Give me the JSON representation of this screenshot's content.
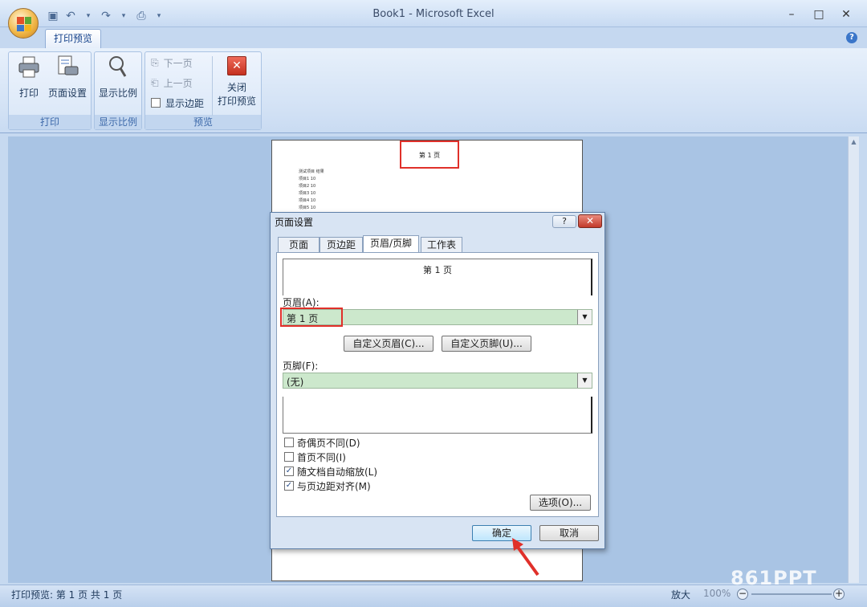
{
  "window": {
    "title": "Book1 - Microsoft Excel",
    "controls": [
      "–",
      "□",
      "✕"
    ]
  },
  "ribbon": {
    "tab": "打印预览",
    "groups": {
      "print": {
        "label": "打印",
        "print_btn": "打印",
        "page_setup_btn": "页面设置"
      },
      "zoom": {
        "label": "显示比例",
        "zoom_btn": "显示比例"
      },
      "preview": {
        "label": "预览",
        "next_page": "下一页",
        "prev_page": "上一页",
        "show_margins": "显示边距",
        "close_line1": "关闭",
        "close_line2": "打印预览"
      }
    }
  },
  "sheet": {
    "header_text": "第 1 页",
    "rows": [
      "测试项目  结果",
      "项目1       10",
      "项目2       10",
      "项目3       10",
      "项目4       10",
      "项目5       10"
    ]
  },
  "dialog": {
    "title": "页面设置",
    "help": "?",
    "close": "✕",
    "tabs": [
      "页面",
      "页边距",
      "页眉/页脚",
      "工作表"
    ],
    "header_preview": "第 1 页",
    "header_label": "页眉(A):",
    "header_value": "第 1 页",
    "custom_header_btn": "自定义页眉(C)...",
    "custom_footer_btn": "自定义页脚(U)...",
    "footer_label": "页脚(F):",
    "footer_value": "(无)",
    "checkboxes": [
      {
        "label": "奇偶页不同(D)",
        "checked": false
      },
      {
        "label": "首页不同(I)",
        "checked": false
      },
      {
        "label": "随文档自动缩放(L)",
        "checked": true
      },
      {
        "label": "与页边距对齐(M)",
        "checked": true
      }
    ],
    "options_btn": "选项(O)...",
    "ok_btn": "确定",
    "cancel_btn": "取消"
  },
  "statusbar": {
    "text": "打印预览: 第 1 页 共 1 页",
    "zoom_label": "放大",
    "zoom_value": "100%"
  },
  "watermark": "861PPT",
  "colors": {
    "highlight": "#e0302a",
    "combo_bg": "#cce8cc"
  }
}
